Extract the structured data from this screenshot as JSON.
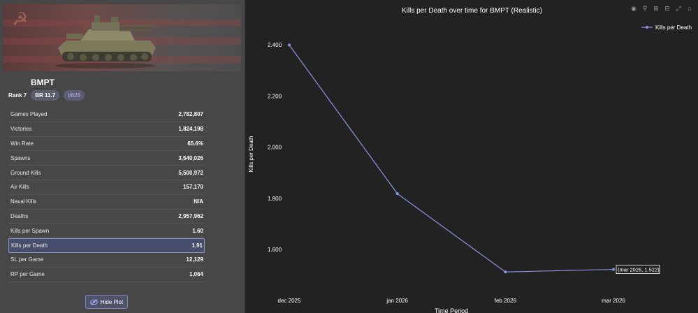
{
  "vehicle": {
    "name": "BMPT",
    "rank": "Rank 7",
    "br": "BR 11.7",
    "id": "#828"
  },
  "stats": [
    {
      "label": "Games Played",
      "value": "2,782,807",
      "selected": false
    },
    {
      "label": "Victories",
      "value": "1,824,198",
      "selected": false
    },
    {
      "label": "Win Rate",
      "value": "65.6%",
      "selected": false
    },
    {
      "label": "Spawns",
      "value": "3,540,026",
      "selected": false
    },
    {
      "label": "Ground Kills",
      "value": "5,500,972",
      "selected": false
    },
    {
      "label": "Air Kills",
      "value": "157,170",
      "selected": false
    },
    {
      "label": "Naval Kills",
      "value": "N/A",
      "selected": false
    },
    {
      "label": "Deaths",
      "value": "2,957,962",
      "selected": false
    },
    {
      "label": "Kills per Spawn",
      "value": "1.60",
      "selected": false
    },
    {
      "label": "Kills per Death",
      "value": "1.91",
      "selected": true
    },
    {
      "label": "SL per Game",
      "value": "12,129",
      "selected": false
    },
    {
      "label": "RP per Game",
      "value": "1,064",
      "selected": false
    }
  ],
  "buttons": {
    "hide_plot": "Hide Plot"
  },
  "toolbar_icons": [
    "camera-icon",
    "zoom-icon",
    "zoom-in-icon",
    "zoom-out-icon",
    "autoscale-icon",
    "reset-axes-icon"
  ],
  "colors": {
    "accent": "#8c93e0",
    "panel": "#474747",
    "chart_bg": "#222222"
  },
  "chart_data": {
    "type": "line",
    "title": "Kills per Death over time for BMPT (Realistic)",
    "xlabel": "Time Period",
    "ylabel": "Kills per Death",
    "categories": [
      "dec 2025",
      "jan 2026",
      "feb 2026",
      "mar 2026"
    ],
    "series": [
      {
        "name": "Kills per Death",
        "values": [
          2.399,
          1.818,
          1.512,
          1.522
        ]
      }
    ],
    "yticks": [
      "1.600",
      "1.800",
      "2.000",
      "2.200",
      "2.400"
    ],
    "ylim": [
      1.45,
      2.5
    ],
    "legend": "top-right",
    "tooltip": "(mar 2026, 1.522)"
  }
}
